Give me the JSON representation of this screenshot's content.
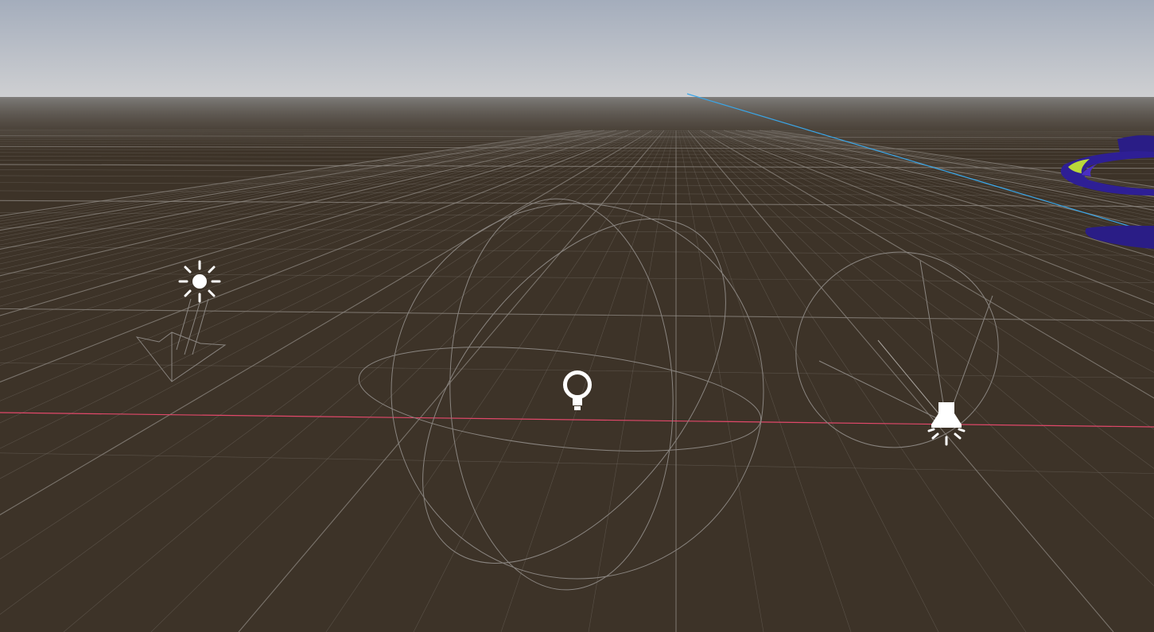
{
  "viewport": {
    "kind": "3D editor viewport",
    "sky_color_top": "#a4adbc",
    "sky_color_horizon": "#cfd0d2",
    "ground_color": "#3d3328",
    "grid_color": "#8f8a83"
  },
  "axes": {
    "x_axis_color": "#e1486a",
    "z_axis_color": "#3aa6e8"
  },
  "gizmos": {
    "directional_light": {
      "icon": "sun-icon",
      "color": "#ffffff"
    },
    "omni_light": {
      "icon": "lightbulb-icon",
      "color": "#ffffff"
    },
    "spot_light": {
      "icon": "spotlight-icon",
      "color": "#ffffff"
    }
  },
  "scene_object": {
    "kind": "ribbon mesh",
    "colors": [
      "#2a1d86",
      "#4a2fc2",
      "#b9d83a"
    ]
  }
}
